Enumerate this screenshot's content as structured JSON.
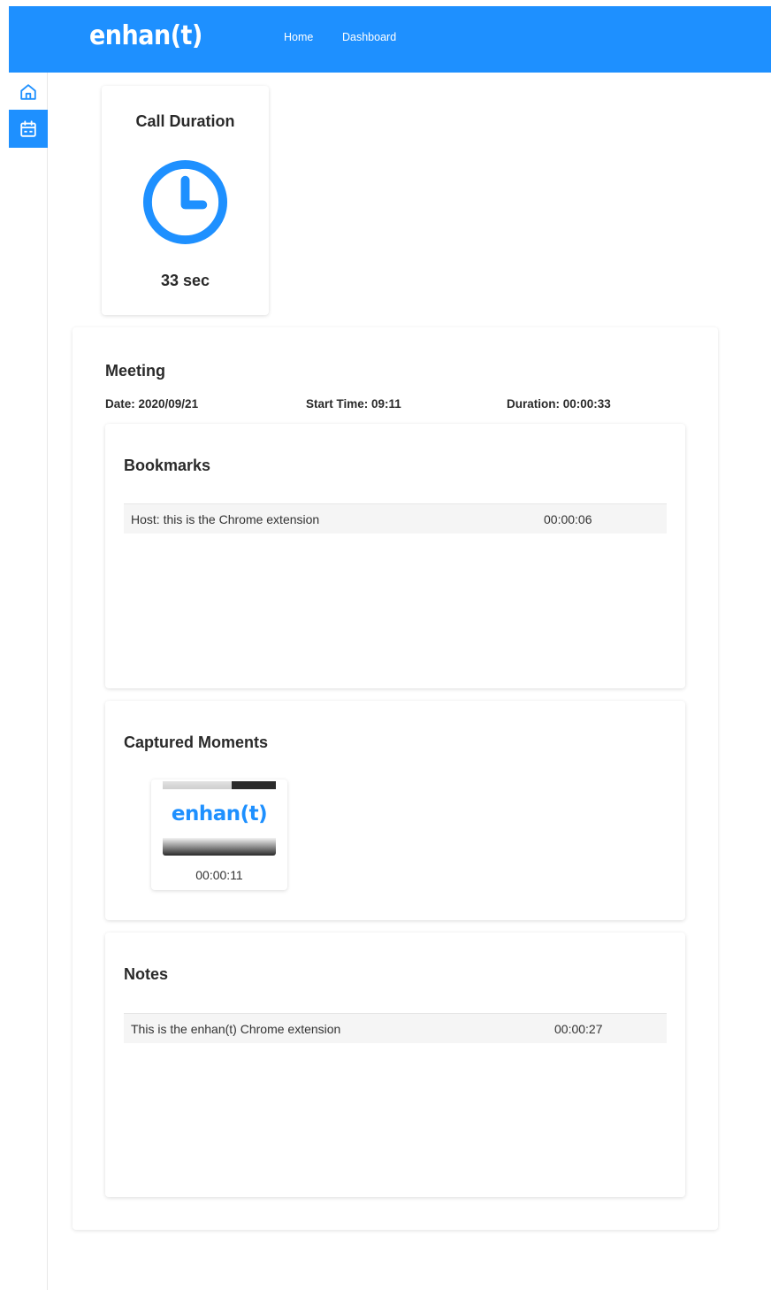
{
  "header": {
    "logo": "enhan(t)",
    "nav": [
      {
        "label": "Home"
      },
      {
        "label": "Dashboard"
      }
    ],
    "background": "#1e90ff"
  },
  "sidebar": {
    "items": [
      {
        "icon": "home-icon",
        "active": false
      },
      {
        "icon": "calendar-icon",
        "active": true
      }
    ]
  },
  "call_duration": {
    "title": "Call Duration",
    "icon": "clock-icon",
    "value": "33 sec"
  },
  "meeting": {
    "title": "Meeting",
    "date": "Date: 2020/09/21",
    "start_time": "Start Time: 09:11",
    "duration": "Duration: 00:00:33",
    "bookmarks": {
      "title": "Bookmarks",
      "items": [
        {
          "text": "Host: this is the Chrome extension",
          "time": "00:00:06"
        }
      ]
    },
    "captured_moments": {
      "title": "Captured Moments",
      "items": [
        {
          "thumbnail_logo": "enhan(t)",
          "time": "00:00:11"
        }
      ]
    },
    "notes": {
      "title": "Notes",
      "items": [
        {
          "text": "This is the enhan(t) Chrome extension",
          "time": "00:00:27"
        }
      ]
    }
  }
}
